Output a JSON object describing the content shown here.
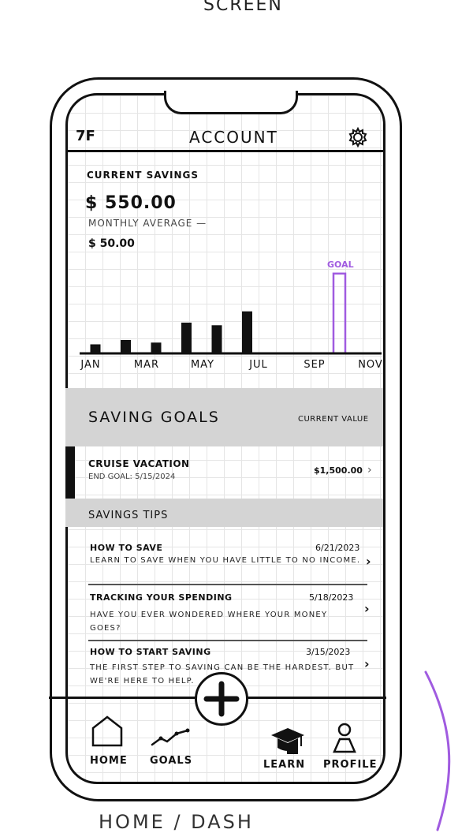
{
  "captions": {
    "top": "SCREEN",
    "bottom": "HOME / DASH"
  },
  "header": {
    "logo": "7F",
    "title": "ACCOUNT",
    "settings_icon": "gear-icon"
  },
  "savings": {
    "label": "CURRENT SAVINGS",
    "amount": "$ 550.00",
    "monthly_label": "MONTHLY AVERAGE —",
    "monthly_value": "$ 50.00"
  },
  "chart_data": {
    "type": "bar",
    "categories": [
      "JAN",
      "FEB",
      "MAR",
      "APR",
      "MAY",
      "JUN",
      "JUL",
      "AUG",
      "SEP"
    ],
    "tick_labels": [
      "JAN",
      "MAR",
      "MAY",
      "JUL",
      "SEP",
      "NOV"
    ],
    "values": [
      10,
      15,
      12,
      35,
      32,
      48,
      0,
      0,
      92
    ],
    "goal_category": "SEP",
    "annotation": "GOAL",
    "colors": {
      "bars": "#111111",
      "goal": "#a05be0"
    }
  },
  "goals": {
    "title": "SAVING GOALS",
    "current_value_label": "CURRENT VALUE",
    "items": [
      {
        "name": "CRUISE VACATION",
        "end_goal": "END GOAL: 5/15/2024",
        "value": "$1,500.00"
      }
    ]
  },
  "tips": {
    "title": "SAVINGS TIPS",
    "items": [
      {
        "title": "HOW TO SAVE",
        "date": "6/21/2023",
        "body": "LEARN TO SAVE WHEN YOU HAVE LITTLE TO NO INCOME."
      },
      {
        "title": "TRACKING YOUR SPENDING",
        "date": "5/18/2023",
        "body": "HAVE YOU EVER WONDERED WHERE YOUR MONEY GOES?"
      },
      {
        "title": "HOW TO START SAVING",
        "date": "3/15/2023",
        "body": "THE FIRST STEP TO SAVING CAN BE THE HARDEST. BUT WE'RE HERE TO HELP."
      }
    ]
  },
  "nav": {
    "home": "HOME",
    "goals": "GOALS",
    "learn": "LEARN",
    "profile": "PROFILE",
    "add_icon": "plus-icon"
  },
  "colors": {
    "accent_purple": "#a05be0",
    "band_gray": "#d4d4d4"
  }
}
